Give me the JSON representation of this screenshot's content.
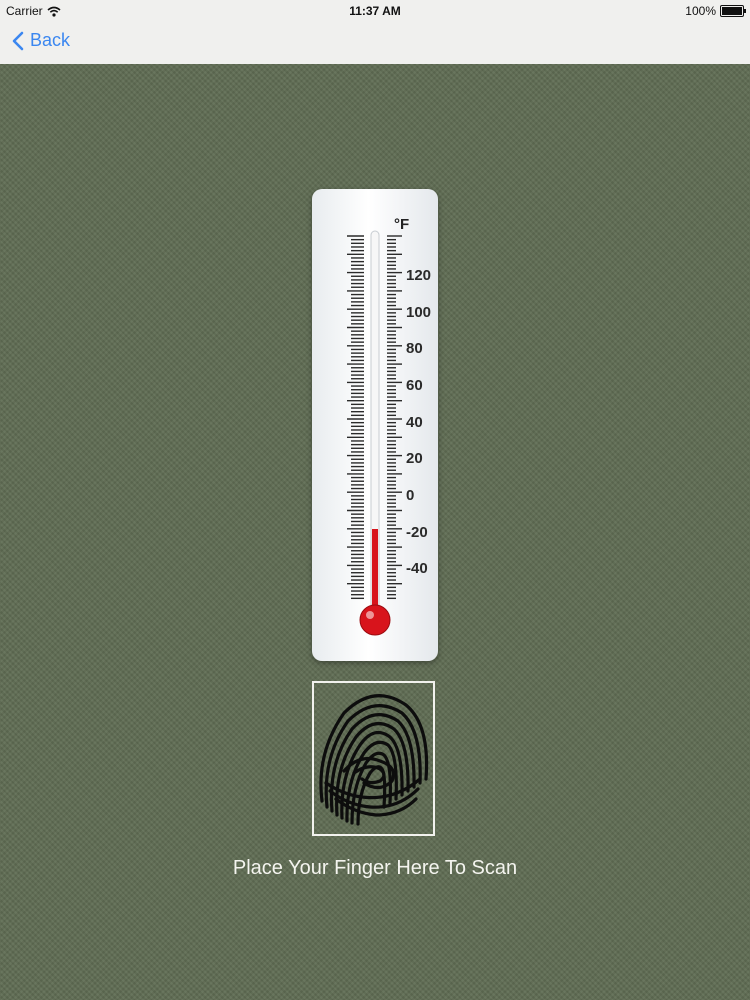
{
  "status_bar": {
    "carrier": "Carrier",
    "time": "11:37 AM",
    "battery": "100%",
    "icons": [
      "wifi-icon",
      "battery-icon"
    ]
  },
  "nav": {
    "back_label": "Back",
    "back_icon": "chevron-left-icon"
  },
  "thermometer": {
    "unit": "°F",
    "tick_labels": [
      "120",
      "100",
      "80",
      "60",
      "40",
      "20",
      "0",
      "-20",
      "-40"
    ],
    "reading_f": -18,
    "mercury_color": "#d8141c"
  },
  "scanner": {
    "icon": "fingerprint-icon",
    "instruction": "Place Your Finger Here To Scan"
  },
  "colors": {
    "accent": "#3b87f0",
    "background": "#5f6c53"
  }
}
